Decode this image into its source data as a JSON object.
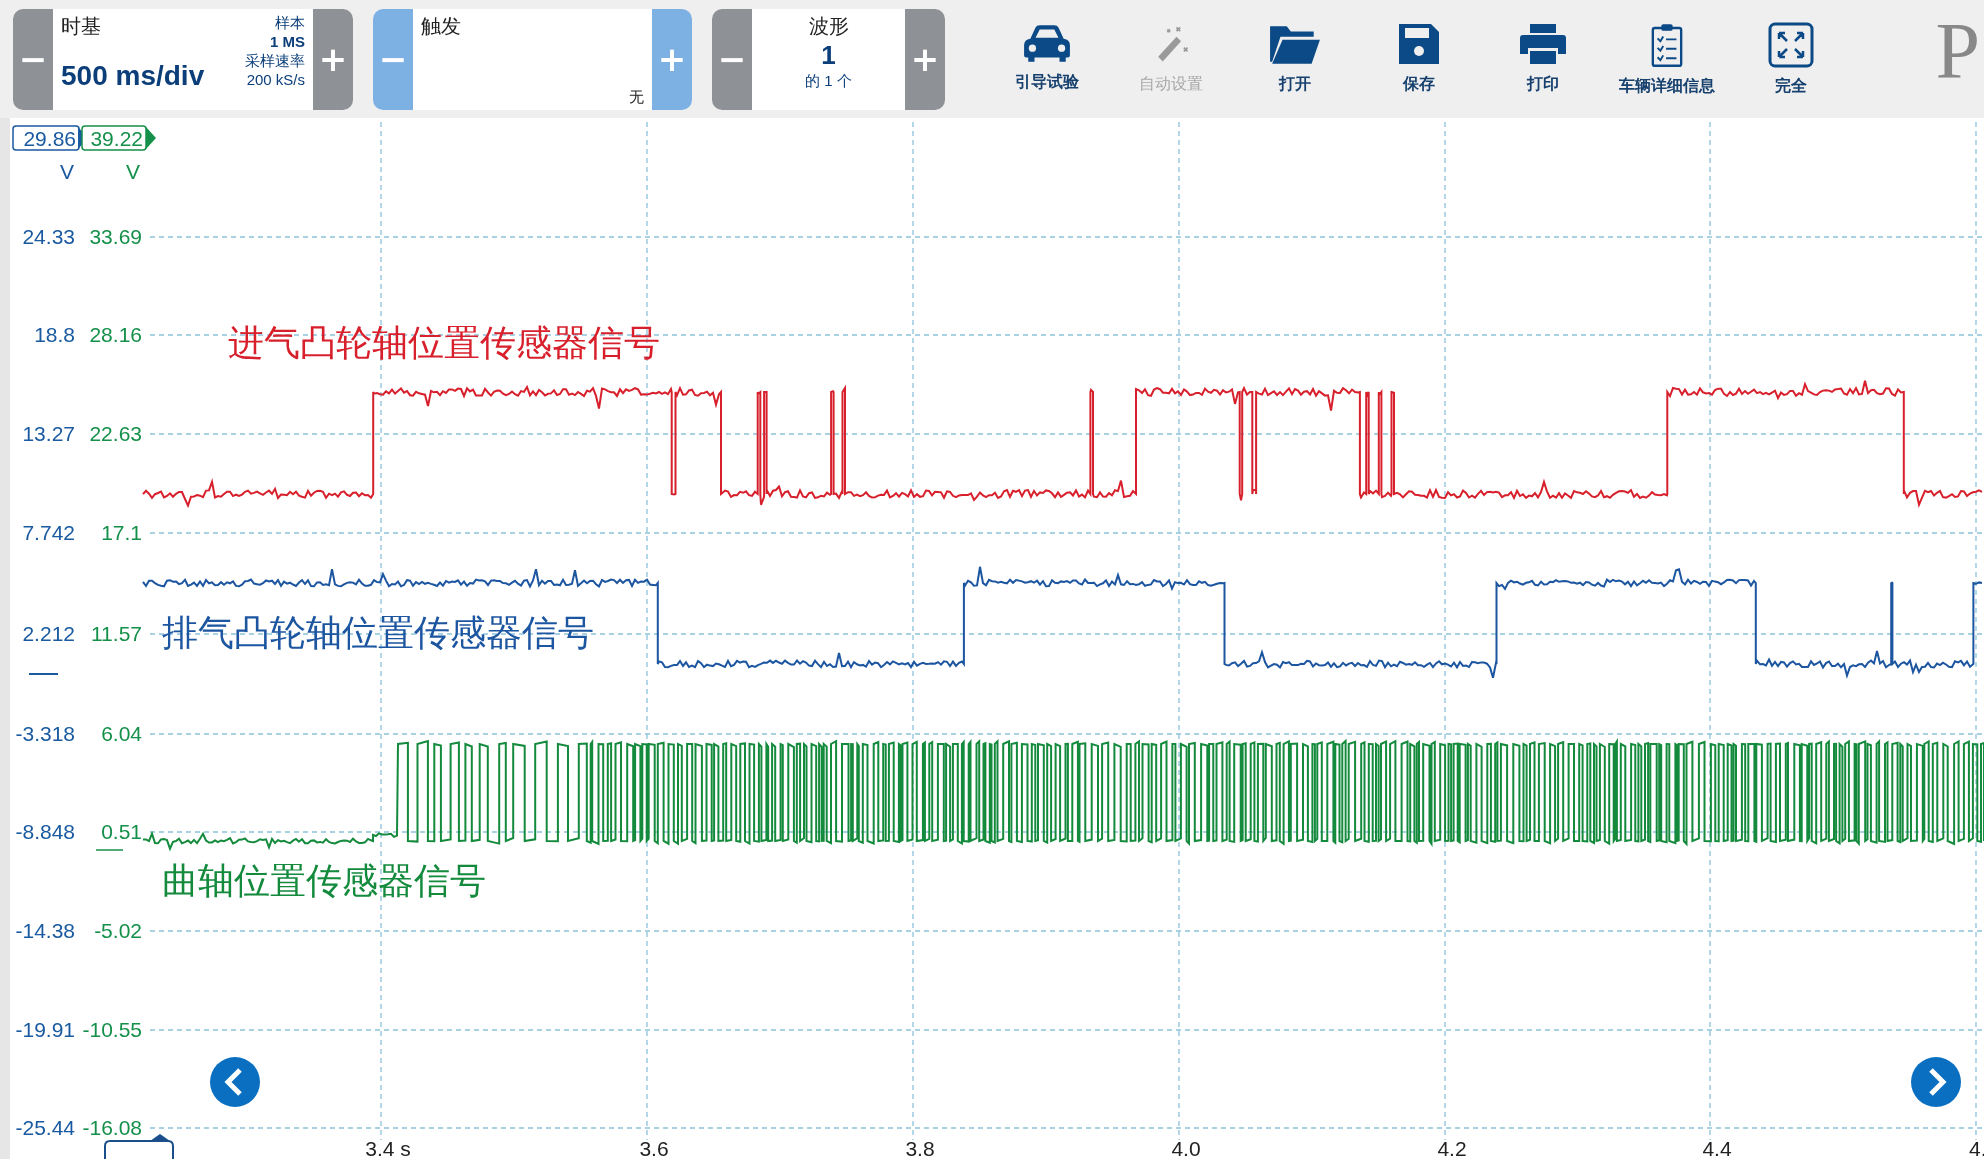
{
  "toolbar": {
    "timebase": {
      "label": "时基",
      "value": "500 ms/div",
      "sample_label": "样本",
      "sample_value": "1 MS",
      "rate_label": "采样速率",
      "rate_value": "200 kS/s",
      "minus": "−",
      "plus": "+"
    },
    "trigger": {
      "label": "触发",
      "value": "无",
      "minus": "−",
      "plus": "+"
    },
    "waveform": {
      "label": "波形",
      "value": "1",
      "count": "的 1 个",
      "minus": "−",
      "plus": "+"
    },
    "actions": [
      {
        "kind": "car",
        "label": "引导试验",
        "disabled": false
      },
      {
        "kind": "wand",
        "label": "自动设置",
        "disabled": true
      },
      {
        "kind": "folder",
        "label": "打开",
        "disabled": false
      },
      {
        "kind": "save",
        "label": "保存",
        "disabled": false
      },
      {
        "kind": "print",
        "label": "打印",
        "disabled": false
      },
      {
        "kind": "clipboard",
        "label": "车辆详细信息",
        "disabled": false
      },
      {
        "kind": "fullscreen",
        "label": "完全",
        "disabled": false
      }
    ],
    "logo": "P"
  },
  "plot": {
    "scales": [
      {
        "color": "#1a5aa0",
        "marker": "29.86",
        "unit": "V",
        "ticks": [
          "24.33",
          "18.8",
          "13.27",
          "7.742",
          "2.212",
          "-3.318",
          "-8.848",
          "-14.38",
          "-19.91",
          "-25.44"
        ]
      },
      {
        "color": "#15904a",
        "marker": "39.22",
        "unit": "V",
        "ticks": [
          "33.69",
          "28.16",
          "22.63",
          "17.1",
          "11.57",
          "6.04",
          "0.51",
          "-5.02",
          "-10.55",
          "-16.08"
        ]
      }
    ],
    "traces": [
      {
        "kind": "intake",
        "label": "进气凸轮轴位置传感器信号",
        "color": "#d8202c"
      },
      {
        "kind": "exhaust",
        "label": "排气凸轮轴位置传感器信号",
        "color": "#1c55a0"
      },
      {
        "kind": "crank",
        "label": "曲轴位置传感器信号",
        "color": "#138a3c"
      }
    ],
    "x_ticks": [
      "3.4 s",
      "3.6",
      "3.8",
      "4.0",
      "4.2",
      "4.4",
      "4."
    ]
  }
}
